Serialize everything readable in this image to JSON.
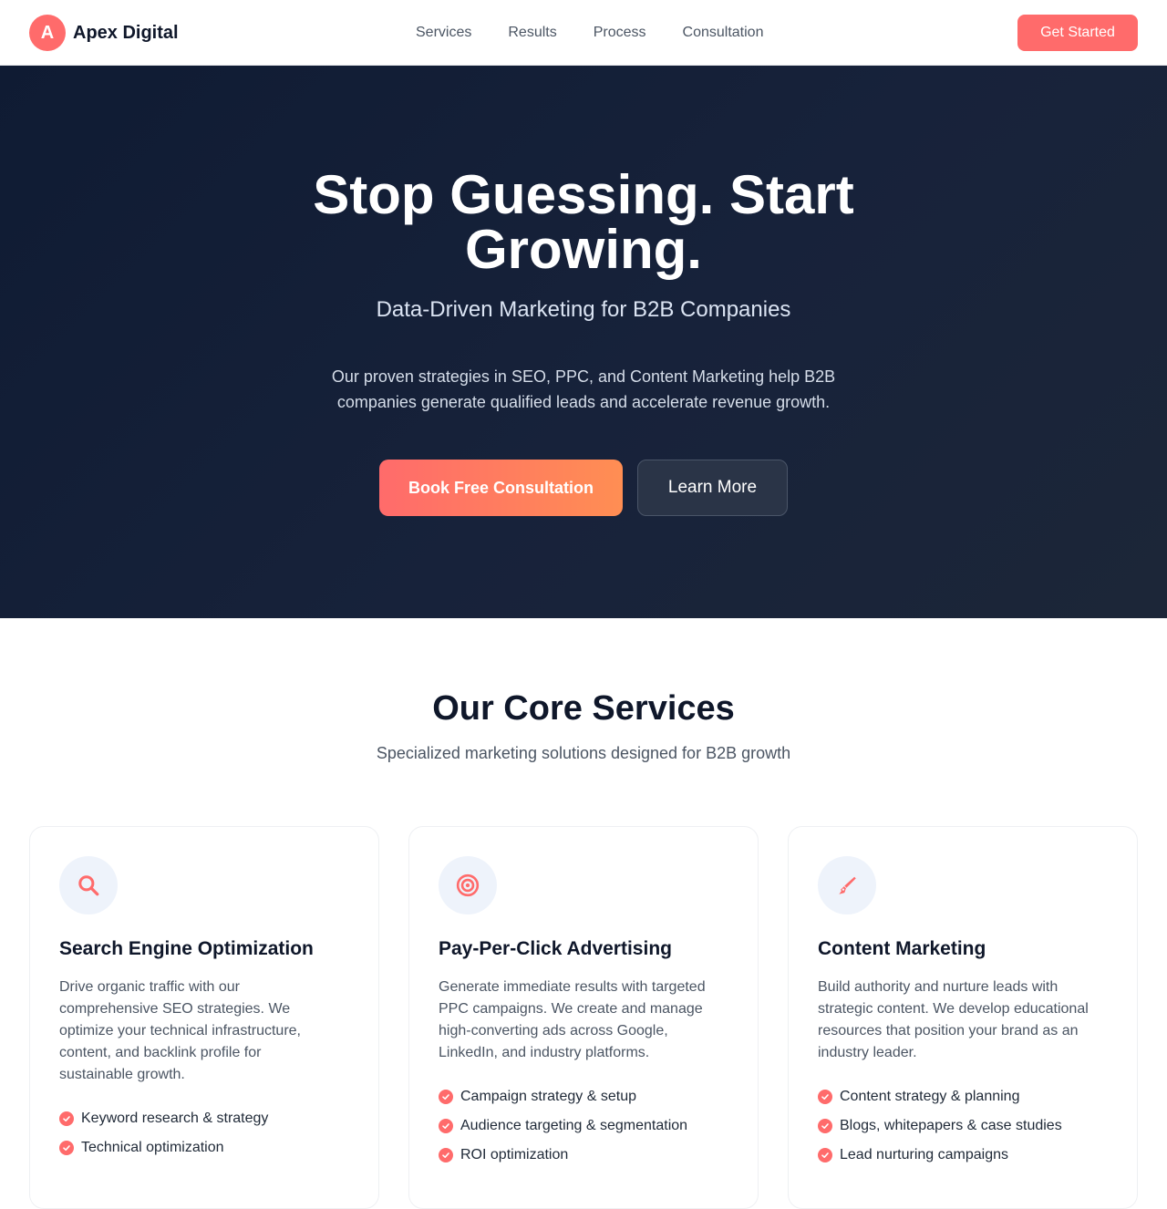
{
  "brand": {
    "mark": "A",
    "name": "Apex Digital"
  },
  "nav": {
    "links": [
      "Services",
      "Results",
      "Process",
      "Consultation"
    ],
    "cta": "Get Started"
  },
  "hero": {
    "title_line1": "Stop Guessing. Start",
    "title_line2": "Growing.",
    "subtitle": "Data-Driven Marketing for B2B Companies",
    "description_line1": "Our proven strategies in SEO, PPC, and Content Marketing help B2B",
    "description_line2": "companies generate qualified leads and accelerate revenue growth.",
    "primary_button": "Book Free Consultation",
    "secondary_button": "Learn More"
  },
  "services": {
    "title": "Our Core Services",
    "subtitle": "Specialized marketing solutions designed for B2B growth",
    "cards": [
      {
        "icon": "search-icon",
        "title": "Search Engine Optimization",
        "description": "Drive organic traffic with our comprehensive SEO strategies. We optimize your technical infrastructure, content, and backlink profile for sustainable growth.",
        "features": [
          "Keyword research & strategy",
          "Technical optimization"
        ]
      },
      {
        "icon": "target-icon",
        "title": "Pay-Per-Click Advertising",
        "description": "Generate immediate results with targeted PPC campaigns. We create and manage high-converting ads across Google, LinkedIn, and industry platforms.",
        "features": [
          "Campaign strategy & setup",
          "Audience targeting & segmentation",
          "ROI optimization"
        ]
      },
      {
        "icon": "pen-icon",
        "title": "Content Marketing",
        "description": "Build authority and nurture leads with strategic content. We develop educational resources that position your brand as an industry leader.",
        "features": [
          "Content strategy & planning",
          "Blogs, whitepapers & case studies",
          "Lead nurturing campaigns"
        ]
      }
    ]
  },
  "colors": {
    "accent": "#ff6b6b",
    "accent_end": "#ff8e53",
    "hero_bg": "#0f1b33",
    "text": "#0f172a",
    "muted": "#4b5563"
  }
}
